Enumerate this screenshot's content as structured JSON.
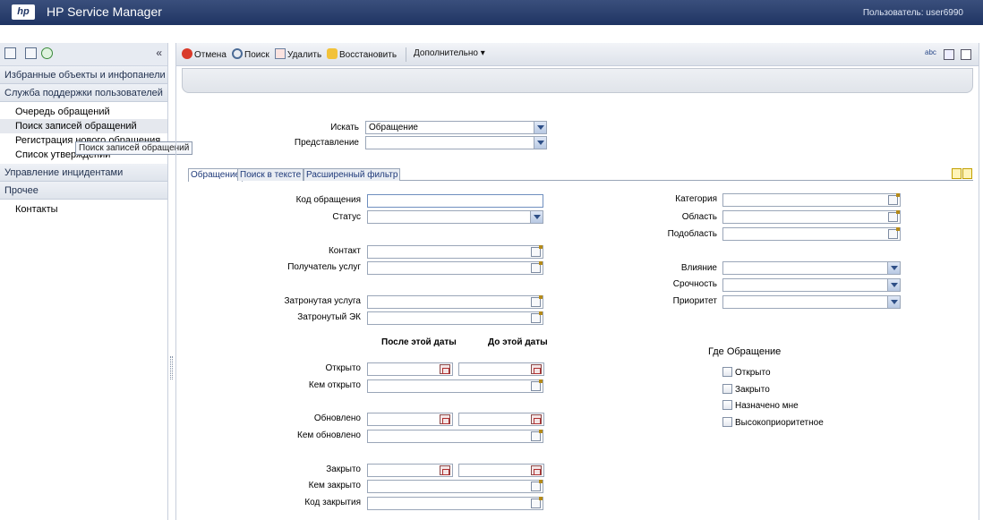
{
  "header": {
    "logo": "hp",
    "title": "HP Service Manager",
    "user": "Пользователь: user6990"
  },
  "sidebar": {
    "collapse_glyph": "«",
    "groups": [
      {
        "label": "Избранные объекты и инфопанели"
      },
      {
        "label": "Служба поддержки пользователей",
        "items": [
          "Очередь обращений",
          "Поиск записей обращений",
          "Регистрация нового обращения",
          "Список утверждений"
        ]
      },
      {
        "label": "Управление инцидентами"
      },
      {
        "label": "Прочее",
        "items": [
          "Контакты"
        ]
      }
    ],
    "tooltip": "Поиск записей обращений"
  },
  "toolbar": {
    "cancel": "Отмена",
    "search": "Поиск",
    "delete": "Удалить",
    "restore": "Восстановить",
    "more": "Дополнительно ▾",
    "spell_glyph": "abc"
  },
  "form": {
    "search_label": "Искать",
    "search_value": "Обращение",
    "view_label": "Представление",
    "view_value": ""
  },
  "tabs": [
    "Обращение",
    "Поиск в тексте",
    "Расширенный фильтр"
  ],
  "fields": {
    "code": "Код обращения",
    "status": "Статус",
    "contact": "Контакт",
    "recipient": "Получатель услуг",
    "service": "Затронутая услуга",
    "ci": "Затронутый ЭК",
    "after_date": "После этой даты",
    "before_date": "До этой даты",
    "opened": "Открыто",
    "opened_by": "Кем открыто",
    "updated": "Обновлено",
    "updated_by": "Кем обновлено",
    "closed": "Закрыто",
    "closed_by": "Кем закрыто",
    "close_code": "Код закрытия",
    "category": "Категория",
    "area": "Область",
    "subarea": "Подобласть",
    "impact": "Влияние",
    "urgency": "Срочность",
    "priority": "Приоритет",
    "where_title": "Где Обращение",
    "cb_open": "Открыто",
    "cb_closed": "Закрыто",
    "cb_assigned": "Назначено мне",
    "cb_high": "Высокоприоритетное"
  },
  "colors": {
    "header_bg": "#1f3463",
    "tab_text": "#1f3a7a"
  }
}
